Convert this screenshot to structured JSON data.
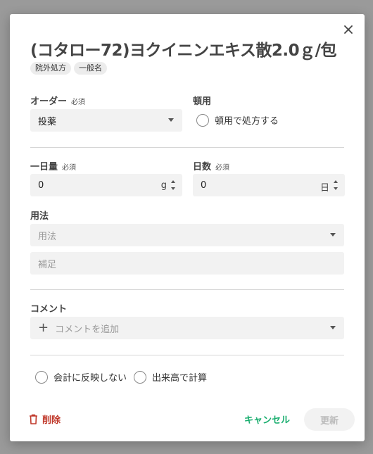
{
  "dialog": {
    "title": "(コタロー72)ヨクイニンエキス散2.0ｇ/包",
    "tags": [
      "院外処方",
      "一般名"
    ]
  },
  "order": {
    "label": "オーダー",
    "required": "必須",
    "value": "投薬"
  },
  "tonpuku": {
    "label": "頓用",
    "option": "頓用で処方する"
  },
  "daily_amount": {
    "label": "一日量",
    "required": "必須",
    "value": "0",
    "unit": "g"
  },
  "days": {
    "label": "日数",
    "required": "必須",
    "value": "0",
    "unit": "日"
  },
  "usage": {
    "label": "用法",
    "placeholder": "用法",
    "supplement_placeholder": "補足"
  },
  "comment": {
    "label": "コメント",
    "add_placeholder": "コメントを追加"
  },
  "options": {
    "billing": "会計に反映しない",
    "dekidaka": "出来高で計算"
  },
  "footer": {
    "delete": "削除",
    "cancel": "キャンセル",
    "update": "更新"
  },
  "colors": {
    "accent": "#1aae6f",
    "danger": "#c0392b"
  }
}
